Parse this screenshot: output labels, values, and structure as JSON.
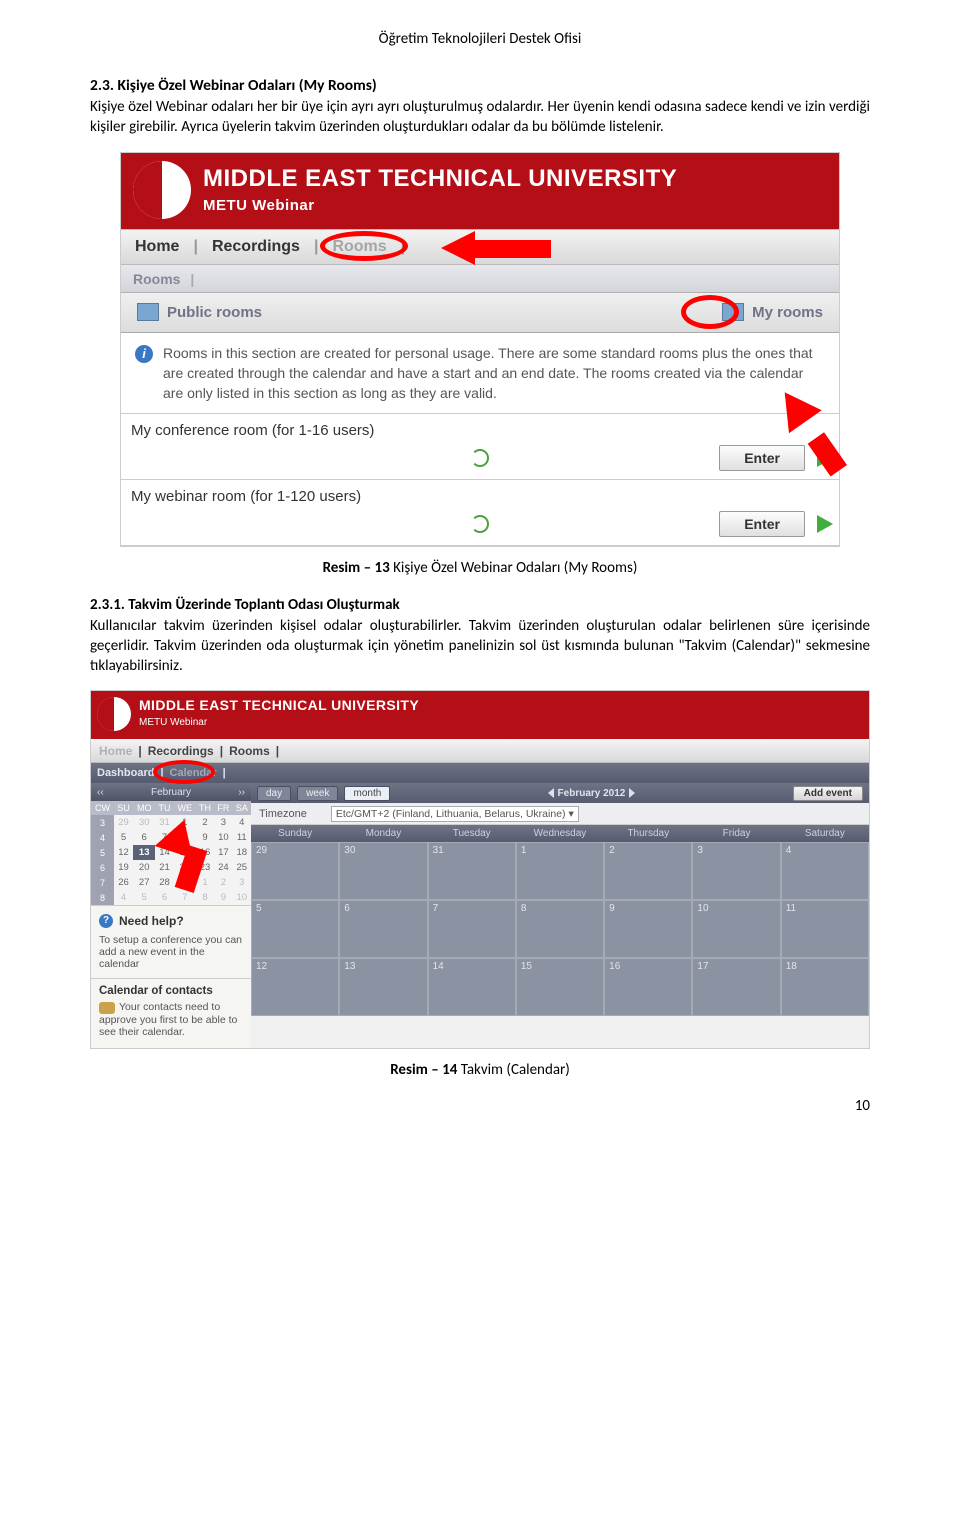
{
  "doc_header": "Öğretim Teknolojileri Destek Ofisi",
  "section1": {
    "heading": "2.3. Kişiye Özel Webinar Odaları (My Rooms)",
    "para": "Kişiye özel Webinar odaları her bir üye için ayrı ayrı oluşturulmuş odalardır. Her üyenin kendi odasına sadece kendi ve izin verdiği kişiler girebilir. Ayrıca üyelerin takvim üzerinden oluşturdukları odalar da bu bölümde listelenir."
  },
  "shot1": {
    "uni": "MIDDLE EAST TECHNICAL UNIVERSITY",
    "sub": "METU Webinar",
    "menu": {
      "home": "Home",
      "recordings": "Recordings",
      "rooms": "Rooms"
    },
    "subbar": "Rooms",
    "tabs": {
      "public": "Public rooms",
      "my": "My rooms"
    },
    "info": "Rooms in this section are created for personal usage. There are some standard rooms plus the ones that are created through the calendar and have a start and an end date. The rooms created via the calendar are only listed in this section as long as they are valid.",
    "rooms": [
      {
        "title": "My conference room (for 1-16 users)",
        "btn": "Enter"
      },
      {
        "title": "My webinar room (for 1-120 users)",
        "btn": "Enter"
      }
    ]
  },
  "caption1": {
    "bold": "Resim – 13",
    "rest": " Kişiye Özel Webinar Odaları (My Rooms)"
  },
  "section2": {
    "heading": "2.3.1. Takvim Üzerinde Toplantı Odası Oluşturmak",
    "para": "Kullanıcılar takvim üzerinden kişisel odalar oluşturabilirler. Takvim üzerinden oluşturulan odalar belirlenen süre içerisinde geçerlidir. Takvim üzerinden oda oluşturmak için yönetim panelinizin sol üst kısmında bulunan \"Takvim (Calendar)\" sekmesine tıklayabilirsiniz."
  },
  "shot2": {
    "uni": "MIDDLE EAST TECHNICAL UNIVERSITY",
    "sub": "METU Webinar",
    "menu": {
      "home": "Home",
      "recordings": "Recordings",
      "rooms": "Rooms"
    },
    "dash": {
      "dashboard": "Dashboard",
      "calendar": "Calendar"
    },
    "mini": {
      "month": "February",
      "dow": [
        "CW",
        "SU",
        "MO",
        "TU",
        "WE",
        "TH",
        "FR",
        "SA"
      ],
      "rows": [
        {
          "wk": "3",
          "d": [
            "29",
            "30",
            "31",
            "1",
            "2",
            "3",
            "4"
          ],
          "dimTo": 2
        },
        {
          "wk": "4",
          "d": [
            "5",
            "6",
            "7",
            "8",
            "9",
            "10",
            "11"
          ]
        },
        {
          "wk": "5",
          "d": [
            "12",
            "13",
            "14",
            "15",
            "16",
            "17",
            "18"
          ],
          "today": 1
        },
        {
          "wk": "6",
          "d": [
            "19",
            "20",
            "21",
            "22",
            "23",
            "24",
            "25"
          ]
        },
        {
          "wk": "7",
          "d": [
            "26",
            "27",
            "28",
            "29",
            "1",
            "2",
            "3"
          ],
          "dimFrom": 4
        },
        {
          "wk": "8",
          "d": [
            "4",
            "5",
            "6",
            "7",
            "8",
            "9",
            "10"
          ],
          "dimFrom": 0
        }
      ]
    },
    "help": {
      "title": "Need help?",
      "text": "To setup a conference you can add a new event in the calendar"
    },
    "contacts": {
      "title": "Calendar of contacts",
      "text": "Your contacts need to approve you first to be able to see their calendar."
    },
    "controls": {
      "view_day": "day",
      "view_week": "week",
      "view_month": "month",
      "month_label": "February 2012",
      "add": "Add event",
      "tz_label": "Timezone",
      "tz_value": "Etc/GMT+2 (Finland, Lithuania, Belarus, Ukraine)"
    },
    "weekdays": [
      "Sunday",
      "Monday",
      "Tuesday",
      "Wednesday",
      "Thursday",
      "Friday",
      "Saturday"
    ],
    "big_rows": [
      [
        "29",
        "30",
        "31",
        "1",
        "2",
        "3",
        "4"
      ],
      [
        "5",
        "6",
        "7",
        "8",
        "9",
        "10",
        "11"
      ],
      [
        "12",
        "13",
        "14",
        "15",
        "16",
        "17",
        "18"
      ]
    ]
  },
  "caption2": {
    "bold": "Resim – 14",
    "rest": " Takvim (Calendar)"
  },
  "page_num": "10"
}
